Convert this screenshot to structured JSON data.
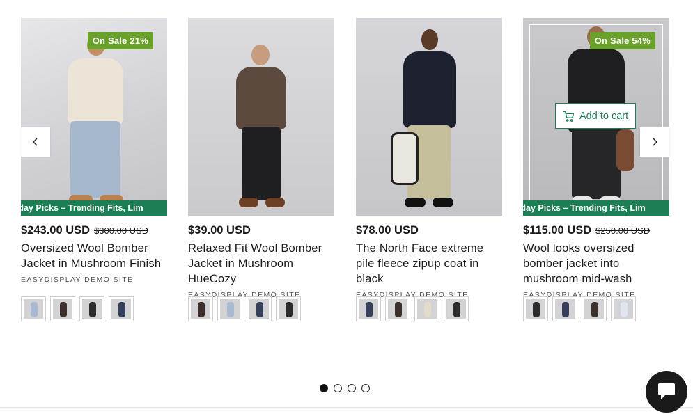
{
  "carousel": {
    "prev_icon": "chevron-left-icon",
    "next_icon": "chevron-right-icon",
    "dots": [
      true,
      false,
      false,
      false
    ]
  },
  "products": [
    {
      "badge": "On Sale 21%",
      "ticker": "ck Friday Picks – Trending Fits, Lim",
      "price": "$243.00 USD",
      "compare": "$300.00 USD",
      "title": "Oversized Wool Bomber Jacket in Mushroom Finish",
      "vendor": "EASYDISPLAY DEMO SITE",
      "swatches": [
        "#a9b9d0",
        "#3d302b",
        "#2c2c2c",
        "#37405a"
      ]
    },
    {
      "price": "$39.00 USD",
      "title": "Relaxed Fit Wool Bomber Jacket in Mushroom HueCozy",
      "vendor": "EASYDISPLAY DEMO SITE",
      "swatches": [
        "#3d302b",
        "#a9b9d0",
        "#37405a",
        "#2c2c2c"
      ]
    },
    {
      "price": "$78.00 USD",
      "title": "The North Face extreme pile fleece zipup coat in black",
      "vendor": "EASYDISPLAY DEMO SITE",
      "swatches": [
        "#37405a",
        "#3d302b",
        "#e4dccb",
        "#2c2c2c"
      ]
    },
    {
      "badge": "On Sale 54%",
      "ticker": "ck Friday Picks – Trending Fits, Lim",
      "add_to_cart": "Add to cart",
      "price": "$115.00 USD",
      "compare": "$250.00 USD",
      "title": "Wool looks oversized bomber jacket into mushroom mid-wash",
      "vendor": "EASYDISPLAY DEMO SITE",
      "swatches": [
        "#2c2c2c",
        "#37405a",
        "#3d302b",
        "#dfe4ee"
      ]
    }
  ],
  "chat": {
    "icon": "chat-bubble-icon"
  }
}
